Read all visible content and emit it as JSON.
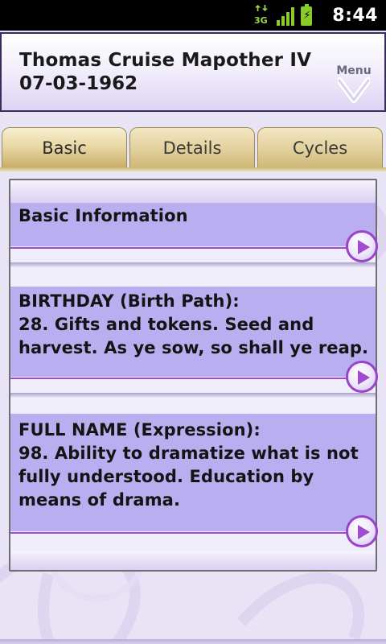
{
  "status_bar": {
    "network": "3G",
    "time": "8:44",
    "icons": [
      "data-arrows-icon",
      "signal-icon",
      "battery-charging-icon"
    ]
  },
  "header": {
    "name": "Thomas Cruise Mapother IV",
    "date": "07-03-1962",
    "menu_label": "Menu"
  },
  "tabs": [
    {
      "label": "Basic",
      "active": true
    },
    {
      "label": "Details",
      "active": false
    },
    {
      "label": "Cycles",
      "active": false
    }
  ],
  "items": [
    {
      "lines": [
        "Basic Information"
      ]
    },
    {
      "lines": [
        "BIRTHDAY (Birth Path):",
        "28. Gifts and tokens. Seed and",
        "harvest. As ye sow, so shall ye reap."
      ]
    },
    {
      "lines": [
        "FULL NAME (Expression):",
        "98. Ability to dramatize what is not",
        "fully understood. Education by",
        "means of drama."
      ]
    }
  ],
  "colors": {
    "accent": "#a24bd0",
    "item_bg": "#b9aef0",
    "tab_bg": "#e0cd98",
    "signal_green": "#8acb2c"
  }
}
